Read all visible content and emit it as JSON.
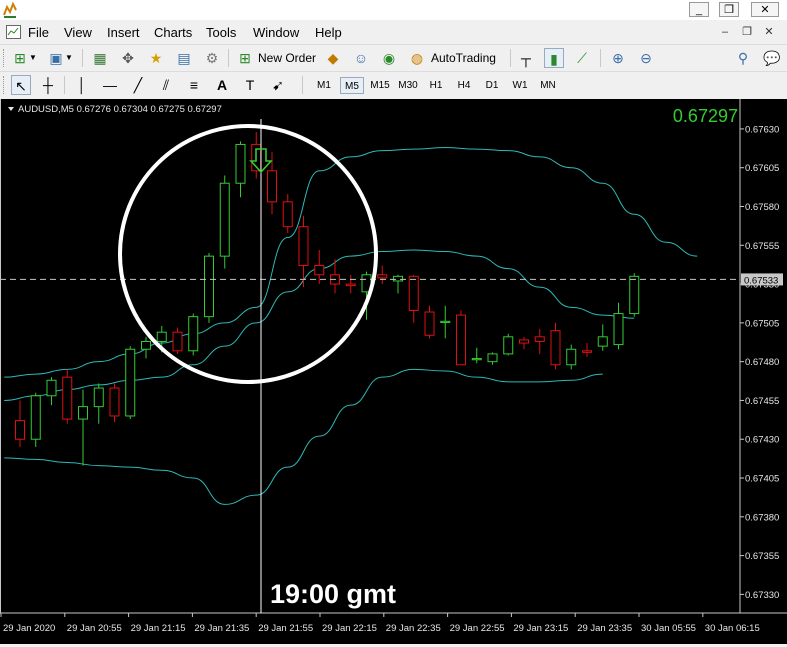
{
  "menu": [
    "File",
    "View",
    "Insert",
    "Charts",
    "Tools",
    "Window",
    "Help"
  ],
  "toolbar": {
    "new_order": "New Order",
    "autotrading": "AutoTrading",
    "timeframes": [
      "M1",
      "M5",
      "M15",
      "M30",
      "H1",
      "H4",
      "D1",
      "W1",
      "MN"
    ],
    "active_timeframe": "M5"
  },
  "chart": {
    "header": "AUDUSD,M5  0.67276 0.67304 0.67275 0.67297",
    "current_price": "0.67297",
    "bid_label": "0.67533",
    "annotation": "19:00 gmt"
  },
  "colors": {
    "bull": "#33cc33",
    "bear": "#dd1111",
    "band": "#2fb8b8",
    "price_text": "#33cc33",
    "circle": "#ffffff"
  },
  "chart_data": {
    "type": "candlestick",
    "symbol": "AUDUSD",
    "timeframe": "M5",
    "ylim": [
      0.67318,
      0.67648
    ],
    "y_ticks": [
      "0.67630",
      "0.67605",
      "0.67580",
      "0.67555",
      "0.67530",
      "0.67505",
      "0.67480",
      "0.67455",
      "0.67430",
      "0.67405",
      "0.67380",
      "0.67355",
      "0.67330"
    ],
    "x_ticks": [
      "29 Jan 2020",
      "29 Jan 20:55",
      "29 Jan 21:15",
      "29 Jan 21:35",
      "29 Jan 21:55",
      "29 Jan 22:15",
      "29 Jan 22:35",
      "29 Jan 22:55",
      "29 Jan 23:15",
      "29 Jan 23:35",
      "30 Jan 05:55",
      "30 Jan 06:15"
    ],
    "candles": [
      [
        0.67442,
        0.67455,
        0.67425,
        0.6743
      ],
      [
        0.6743,
        0.6746,
        0.67425,
        0.67458
      ],
      [
        0.67458,
        0.6747,
        0.67452,
        0.67468
      ],
      [
        0.6747,
        0.67475,
        0.6744,
        0.67443
      ],
      [
        0.67443,
        0.67462,
        0.67413,
        0.67451
      ],
      [
        0.67451,
        0.67466,
        0.6744,
        0.67463
      ],
      [
        0.67463,
        0.67466,
        0.67441,
        0.67445
      ],
      [
        0.67445,
        0.6749,
        0.67443,
        0.67488
      ],
      [
        0.67488,
        0.67496,
        0.67482,
        0.67493
      ],
      [
        0.67493,
        0.67503,
        0.67486,
        0.67499
      ],
      [
        0.67499,
        0.67502,
        0.67485,
        0.67487
      ],
      [
        0.67487,
        0.67511,
        0.67484,
        0.67509
      ],
      [
        0.67509,
        0.6755,
        0.67505,
        0.67548
      ],
      [
        0.67548,
        0.676,
        0.6754,
        0.67595
      ],
      [
        0.67595,
        0.67622,
        0.67586,
        0.6762
      ],
      [
        0.6762,
        0.67628,
        0.67598,
        0.67603
      ],
      [
        0.67603,
        0.67615,
        0.67575,
        0.67583
      ],
      [
        0.67583,
        0.67588,
        0.67563,
        0.67567
      ],
      [
        0.67567,
        0.67574,
        0.67528,
        0.67542
      ],
      [
        0.67542,
        0.67552,
        0.6753,
        0.67536
      ],
      [
        0.67536,
        0.67546,
        0.67524,
        0.6753
      ],
      [
        0.6753,
        0.67536,
        0.67524,
        0.67529
      ],
      [
        0.67525,
        0.67538,
        0.67507,
        0.67536
      ],
      [
        0.67536,
        0.67542,
        0.6753,
        0.67534
      ],
      [
        0.67532,
        0.67536,
        0.67524,
        0.67535
      ],
      [
        0.67535,
        0.67536,
        0.67505,
        0.67513
      ],
      [
        0.67512,
        0.67516,
        0.67495,
        0.67497
      ],
      [
        0.67506,
        0.67516,
        0.67495,
        0.67506
      ],
      [
        0.6751,
        0.67513,
        0.67478,
        0.67478
      ],
      [
        0.67482,
        0.67489,
        0.67479,
        0.67482
      ],
      [
        0.6748,
        0.67486,
        0.67478,
        0.67485
      ],
      [
        0.67485,
        0.67498,
        0.67484,
        0.67496
      ],
      [
        0.67494,
        0.67496,
        0.67488,
        0.67492
      ],
      [
        0.67496,
        0.67501,
        0.67485,
        0.67493
      ],
      [
        0.675,
        0.67505,
        0.67475,
        0.67478
      ],
      [
        0.67478,
        0.67491,
        0.67475,
        0.67488
      ],
      [
        0.67487,
        0.67492,
        0.67483,
        0.67486
      ],
      [
        0.6749,
        0.67504,
        0.67487,
        0.67496
      ],
      [
        0.67491,
        0.67518,
        0.67488,
        0.67511
      ],
      [
        0.67511,
        0.67537,
        0.67509,
        0.67535
      ]
    ],
    "bands": {
      "upper": [
        0.6747,
        0.67472,
        0.67475,
        0.6748,
        0.67485,
        0.67492,
        0.67498,
        0.67505,
        0.67515,
        0.6756,
        0.67603,
        0.67612,
        0.67616,
        0.67617,
        0.67618,
        0.67617,
        0.67616,
        0.67612,
        0.67605,
        0.67595,
        0.67575,
        0.67557,
        0.67548
      ],
      "middle": [
        0.67455,
        0.67458,
        0.67462,
        0.67465,
        0.67468,
        0.6747,
        0.67478,
        0.6749,
        0.67505,
        0.67525,
        0.6754,
        0.67548,
        0.67551,
        0.67552,
        0.67551,
        0.67548,
        0.6754,
        0.67528,
        0.67515,
        0.6751,
        0.67508
      ],
      "lower": [
        0.67418,
        0.67417,
        0.67415,
        0.67413,
        0.67412,
        0.6741,
        0.67405,
        0.67388,
        0.67394,
        0.67412,
        0.67432,
        0.67452,
        0.6747,
        0.67475,
        0.67474,
        0.6747,
        0.67467,
        0.67467,
        0.67468,
        0.67472
      ]
    }
  }
}
